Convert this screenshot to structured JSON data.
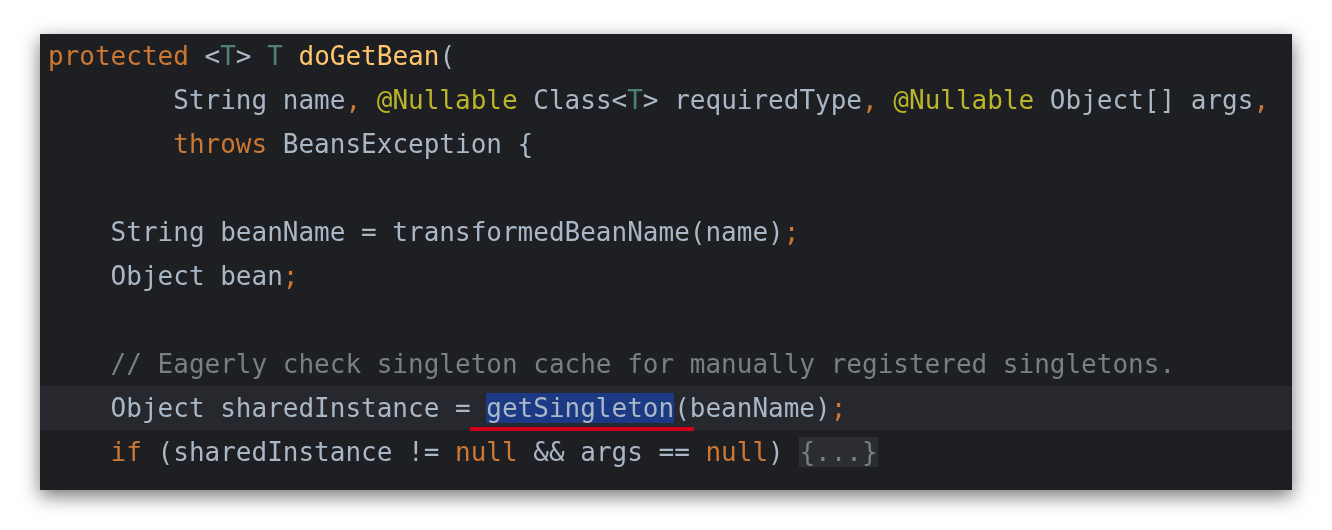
{
  "editor": {
    "lines": [
      {
        "kind": "code",
        "current": false,
        "tokens": [
          {
            "text": "protected",
            "kind": "keyword"
          },
          {
            "text": " <",
            "kind": "plain"
          },
          {
            "text": "T",
            "kind": "type_param"
          },
          {
            "text": "> ",
            "kind": "plain"
          },
          {
            "text": "T",
            "kind": "type_param"
          },
          {
            "text": " doGetBean",
            "kind": "function"
          },
          {
            "text": "(",
            "kind": "plain"
          }
        ]
      },
      {
        "kind": "code",
        "current": false,
        "tokens": [
          {
            "text": "        String name",
            "kind": "plain"
          },
          {
            "text": ", ",
            "kind": "keyword"
          },
          {
            "text": "@Nullable",
            "kind": "annotation"
          },
          {
            "text": " Class<",
            "kind": "plain"
          },
          {
            "text": "T",
            "kind": "type_param"
          },
          {
            "text": "> requiredType",
            "kind": "plain"
          },
          {
            "text": ", ",
            "kind": "keyword"
          },
          {
            "text": "@Nullable",
            "kind": "annotation"
          },
          {
            "text": " Object[] args",
            "kind": "plain"
          },
          {
            "text": ",",
            "kind": "keyword"
          }
        ]
      },
      {
        "kind": "code",
        "current": false,
        "tokens": [
          {
            "text": "        throws",
            "kind": "keyword"
          },
          {
            "text": " BeansException {",
            "kind": "plain"
          }
        ]
      },
      {
        "kind": "blank",
        "current": false
      },
      {
        "kind": "code",
        "current": false,
        "tokens": [
          {
            "text": "    String beanName = transformedBeanName(name)",
            "kind": "plain"
          },
          {
            "text": ";",
            "kind": "keyword"
          }
        ]
      },
      {
        "kind": "code",
        "current": false,
        "tokens": [
          {
            "text": "    Object bean",
            "kind": "plain"
          },
          {
            "text": ";",
            "kind": "keyword"
          }
        ]
      },
      {
        "kind": "blank",
        "current": false
      },
      {
        "kind": "code",
        "current": false,
        "tokens": [
          {
            "text": "    // Eagerly check singleton cache for manually registered singletons.",
            "kind": "comment"
          }
        ]
      },
      {
        "kind": "code",
        "current": true,
        "tokens": [
          {
            "text": "    Object sharedInstance = ",
            "kind": "plain"
          },
          {
            "text": "getSingleton",
            "kind": "plain",
            "selected": true
          },
          {
            "text": "(beanName)",
            "kind": "plain"
          },
          {
            "text": ";",
            "kind": "keyword"
          }
        ]
      },
      {
        "kind": "code",
        "current": false,
        "tokens": [
          {
            "text": "    if",
            "kind": "keyword"
          },
          {
            "text": " (sharedInstance != ",
            "kind": "plain"
          },
          {
            "text": "null",
            "kind": "keyword"
          },
          {
            "text": " && args == ",
            "kind": "plain"
          },
          {
            "text": "null",
            "kind": "keyword"
          },
          {
            "text": ") ",
            "kind": "plain"
          },
          {
            "text": "{...}",
            "kind": "folded"
          }
        ]
      }
    ]
  }
}
